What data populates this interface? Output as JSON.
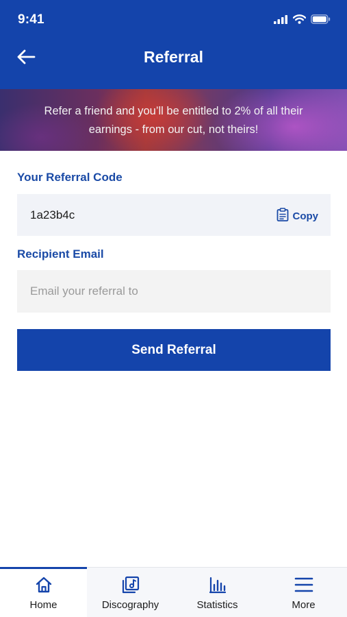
{
  "status_bar": {
    "time": "9:41"
  },
  "header": {
    "title": "Referral"
  },
  "banner": {
    "text": "Refer a friend and you’ll be entitled to 2% of all their earnings - from our cut, not theirs!"
  },
  "referral_code": {
    "label": "Your Referral Code",
    "value": "1a23b4c",
    "copy_label": "Copy"
  },
  "recipient": {
    "label": "Recipient Email",
    "value": "",
    "placeholder": "Email your referral to"
  },
  "send_button": {
    "label": "Send Referral"
  },
  "tab_bar": {
    "items": [
      {
        "label": "Home",
        "icon": "home-icon",
        "active": true
      },
      {
        "label": "Discography",
        "icon": "music-album-icon",
        "active": false
      },
      {
        "label": "Statistics",
        "icon": "bar-chart-icon",
        "active": false
      },
      {
        "label": "More",
        "icon": "menu-icon",
        "active": false
      }
    ]
  },
  "colors": {
    "brand": "#1444ab",
    "label": "#1a4aa6",
    "input_bg": "#f3f3f3",
    "code_bg": "#f1f3f8"
  }
}
